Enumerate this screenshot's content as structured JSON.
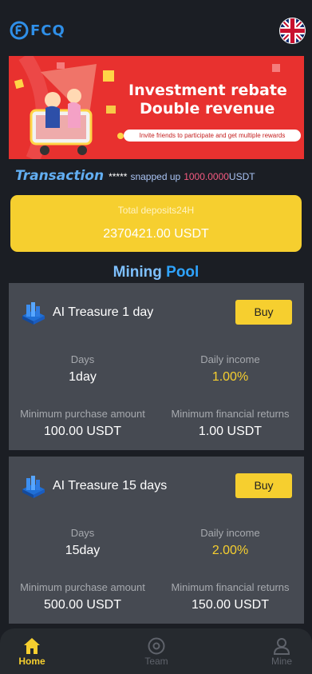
{
  "header": {
    "logo_text": "FCQ",
    "language_icon": "uk-flag-icon"
  },
  "banner": {
    "headline_line1": "Investment rebate",
    "headline_line2": "Double revenue",
    "subline": "Invite friends to participate and get multiple rewards"
  },
  "transaction": {
    "title": "Transaction",
    "name": "*****",
    "action": "snapped up",
    "amount": "1000.0000",
    "unit": "USDT"
  },
  "deposits": {
    "label": "Total deposits24H",
    "value": "2370421.00 USDT"
  },
  "pool": {
    "title_part1": "Mining",
    "title_part2": "Pool"
  },
  "cards": [
    {
      "name": "AI Treasure 1 day",
      "buy_label": "Buy",
      "days_label": "Days",
      "days_value": "1day",
      "income_label": "Daily income",
      "income_value": "1.00%",
      "min_purchase_label": "Minimum purchase amount",
      "min_purchase_value": "100.00 USDT",
      "min_return_label": "Minimum financial returns",
      "min_return_value": "1.00 USDT"
    },
    {
      "name": "AI Treasure 15 days",
      "buy_label": "Buy",
      "days_label": "Days",
      "days_value": "15day",
      "income_label": "Daily income",
      "income_value": "2.00%",
      "min_purchase_label": "Minimum purchase amount",
      "min_purchase_value": "500.00 USDT",
      "min_return_label": "Minimum financial returns",
      "min_return_value": "150.00 USDT"
    }
  ],
  "tabs": [
    {
      "label": "Home",
      "icon": "home-icon",
      "active": true
    },
    {
      "label": "Team",
      "icon": "team-icon",
      "active": false
    },
    {
      "label": "Mine",
      "icon": "user-icon",
      "active": false
    }
  ],
  "colors": {
    "accent": "#f6cf2f",
    "background": "#1b1e24",
    "card": "#464a52",
    "banner": "#e8312f",
    "link": "#62aef2"
  }
}
